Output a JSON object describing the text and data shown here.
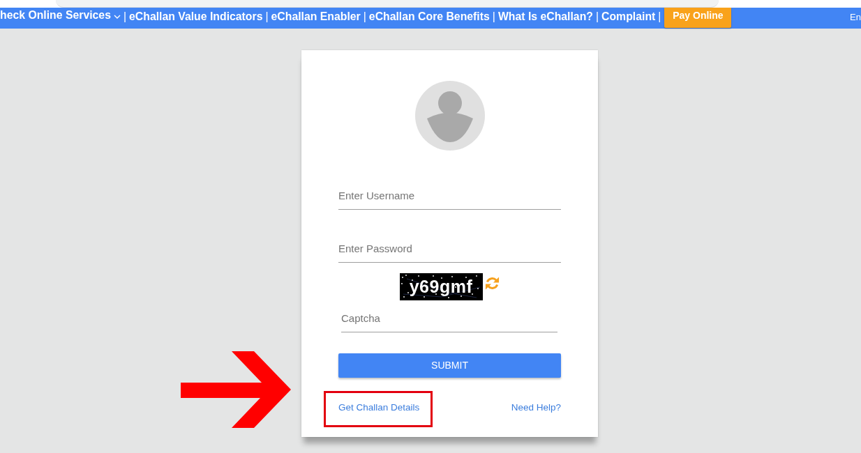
{
  "nav": {
    "items": [
      {
        "kind": "dropdown",
        "label": "heck Online Services"
      },
      {
        "kind": "separator",
        "label": "|"
      },
      {
        "kind": "link",
        "label": "eChallan Value Indicators"
      },
      {
        "kind": "separator",
        "label": "|"
      },
      {
        "kind": "link",
        "label": "eChallan Enabler"
      },
      {
        "kind": "separator",
        "label": "|"
      },
      {
        "kind": "link",
        "label": "eChallan Core Benefits"
      },
      {
        "kind": "separator",
        "label": "|"
      },
      {
        "kind": "link",
        "label": "What Is eChallan?"
      },
      {
        "kind": "separator",
        "label": "|"
      },
      {
        "kind": "link",
        "label": "Complaint"
      },
      {
        "kind": "separator",
        "label": "|"
      }
    ],
    "pay_button": "Pay Online",
    "language": "En"
  },
  "login": {
    "fields": [
      {
        "placeholder": "Enter Username"
      },
      {
        "placeholder": "Enter Password"
      }
    ],
    "captcha": {
      "code": "y69gmf",
      "placeholder": "Captcha"
    },
    "submit": "SUBMIT",
    "links": [
      {
        "label": "Get Challan Details",
        "highlighted": true
      },
      {
        "label": "Need Help?",
        "highlighted": false
      }
    ]
  }
}
